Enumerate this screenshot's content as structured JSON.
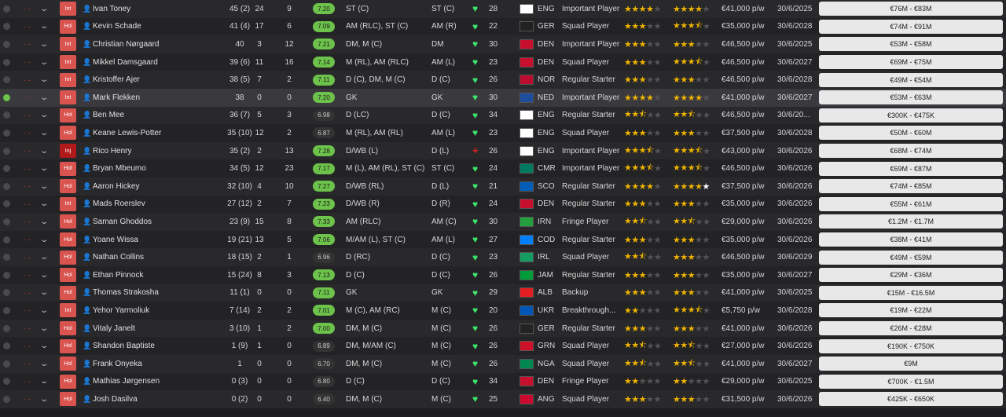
{
  "flag_colors": {
    "ENG": "#ffffff",
    "GER": "#222222",
    "DEN": "#c8102e",
    "NOR": "#ba0c2f",
    "NED": "#1e4d9e",
    "CMR": "#007a5e",
    "SCO": "#005eb8",
    "IRN": "#239f40",
    "COD": "#007fff",
    "IRL": "#169b62",
    "JAM": "#009b3a",
    "ALB": "#e41e20",
    "UKR": "#0057b7",
    "GRN": "#ce1126",
    "NGA": "#008751",
    "ANG": "#cc092f"
  },
  "players": [
    {
      "status": "Int",
      "name": "Ivan Toney",
      "apps": "45 (2)",
      "goals": "24",
      "ast": "9",
      "rating": "7.20",
      "pos": "ST (C)",
      "bpos": "ST (C)",
      "age": "28",
      "nat": "ENG",
      "role": "Important Player",
      "stars1": 4,
      "stars2": 4,
      "wage": "€41,000 p/w",
      "exp": "30/6/2025",
      "value": "€76M - €83M"
    },
    {
      "status": "Hol",
      "name": "Kevin Schade",
      "apps": "41 (4)",
      "goals": "17",
      "ast": "6",
      "rating": "7.09",
      "pos": "AM (RLC), ST (C)",
      "bpos": "AM (R)",
      "age": "22",
      "nat": "GER",
      "role": "Squad Player",
      "stars1": 3,
      "stars2": 3.5,
      "wage": "€35,000 p/w",
      "exp": "30/6/2028",
      "value": "€74M - €91M"
    },
    {
      "status": "Int",
      "name": "Christian Nørgaard",
      "apps": "40",
      "goals": "3",
      "ast": "12",
      "rating": "7.21",
      "pos": "DM, M (C)",
      "bpos": "DM",
      "age": "30",
      "nat": "DEN",
      "role": "Important Player",
      "stars1": 3,
      "stars2": 3,
      "wage": "€46,500 p/w",
      "exp": "30/6/2025",
      "value": "€53M - €58M"
    },
    {
      "status": "Int",
      "name": "Mikkel Damsgaard",
      "apps": "39 (6)",
      "goals": "11",
      "ast": "16",
      "rating": "7.14",
      "pos": "M (RL), AM (RLC)",
      "bpos": "AM (L)",
      "age": "23",
      "nat": "DEN",
      "role": "Squad Player",
      "stars1": 3,
      "stars2": 3.5,
      "wage": "€46,500 p/w",
      "exp": "30/6/2027",
      "value": "€69M - €75M"
    },
    {
      "status": "Int",
      "name": "Kristoffer Ajer",
      "apps": "38 (5)",
      "goals": "7",
      "ast": "2",
      "rating": "7.11",
      "pos": "D (C), DM, M (C)",
      "bpos": "D (C)",
      "age": "26",
      "nat": "NOR",
      "role": "Regular Starter",
      "stars1": 3,
      "stars2": 3,
      "wage": "€46,500 p/w",
      "exp": "30/6/2028",
      "value": "€49M - €54M"
    },
    {
      "status": "Int",
      "name": "Mark Flekken",
      "apps": "38",
      "goals": "0",
      "ast": "0",
      "rating": "7.20",
      "pos": "GK",
      "bpos": "GK",
      "age": "30",
      "nat": "NED",
      "role": "Important Player",
      "stars1": 4,
      "stars2": 4,
      "wage": "€41,000 p/w",
      "exp": "30/6/2027",
      "value": "€53M - €63M"
    },
    {
      "status": "Hol",
      "name": "Ben Mee",
      "apps": "36 (7)",
      "goals": "5",
      "ast": "3",
      "rating": "6.98",
      "pos": "D (LC)",
      "bpos": "D (C)",
      "age": "34",
      "nat": "ENG",
      "role": "Regular Starter",
      "stars1": 2.5,
      "stars2": 2.5,
      "wage": "€46,500 p/w",
      "exp": "30/6/20...",
      "value": "€300K - €475K"
    },
    {
      "status": "Hol",
      "name": "Keane Lewis-Potter",
      "apps": "35 (10)",
      "goals": "12",
      "ast": "2",
      "rating": "6.87",
      "pos": "M (RL), AM (RL)",
      "bpos": "AM (L)",
      "age": "23",
      "nat": "ENG",
      "role": "Squad Player",
      "stars1": 3,
      "stars2": 3,
      "wage": "€37,500 p/w",
      "exp": "30/6/2028",
      "value": "€50M - €60M"
    },
    {
      "status": "Inj",
      "name": "Rico Henry",
      "apps": "35 (2)",
      "goals": "2",
      "ast": "13",
      "rating": "7.28",
      "pos": "D/WB (L)",
      "bpos": "D (L)",
      "age": "26",
      "nat": "ENG",
      "role": "Important Player",
      "stars1": 3.5,
      "stars2": 3.5,
      "wage": "€43,000 p/w",
      "exp": "30/6/2026",
      "value": "€68M - €74M"
    },
    {
      "status": "Hol",
      "name": "Bryan Mbeumo",
      "apps": "34 (5)",
      "goals": "12",
      "ast": "23",
      "rating": "7.17",
      "pos": "M (L), AM (RL), ST (C)",
      "bpos": "ST (C)",
      "age": "24",
      "nat": "CMR",
      "role": "Important Player",
      "stars1": 3.5,
      "stars2": 3.5,
      "wage": "€46,500 p/w",
      "exp": "30/6/2026",
      "value": "€69M - €87M"
    },
    {
      "status": "Hol",
      "name": "Aaron Hickey",
      "apps": "32 (10)",
      "goals": "4",
      "ast": "10",
      "rating": "7.27",
      "pos": "D/WB (RL)",
      "bpos": "D (L)",
      "age": "21",
      "nat": "SCO",
      "role": "Regular Starter",
      "stars1": 4,
      "stars2": 5,
      "wage": "€37,500 p/w",
      "exp": "30/6/2026",
      "value": "€74M - €85M"
    },
    {
      "status": "Int",
      "name": "Mads Roerslev",
      "apps": "27 (12)",
      "goals": "2",
      "ast": "7",
      "rating": "7.23",
      "pos": "D/WB (R)",
      "bpos": "D (R)",
      "age": "24",
      "nat": "DEN",
      "role": "Regular Starter",
      "stars1": 3,
      "stars2": 3,
      "wage": "€35,000 p/w",
      "exp": "30/6/2026",
      "value": "€55M - €61M"
    },
    {
      "status": "Hol",
      "name": "Saman Ghoddos",
      "apps": "23 (9)",
      "goals": "15",
      "ast": "8",
      "rating": "7.33",
      "pos": "AM (RLC)",
      "bpos": "AM (C)",
      "age": "30",
      "nat": "IRN",
      "role": "Fringe Player",
      "stars1": 2.5,
      "stars2": 2.5,
      "wage": "€29,000 p/w",
      "exp": "30/6/2026",
      "value": "€1.2M - €1.7M"
    },
    {
      "status": "Hol",
      "name": "Yoane Wissa",
      "apps": "19 (21)",
      "goals": "13",
      "ast": "5",
      "rating": "7.06",
      "pos": "M/AM (L), ST (C)",
      "bpos": "AM (L)",
      "age": "27",
      "nat": "COD",
      "role": "Regular Starter",
      "stars1": 3,
      "stars2": 3,
      "wage": "€35,000 p/w",
      "exp": "30/6/2026",
      "value": "€38M - €41M"
    },
    {
      "status": "Hol",
      "name": "Nathan Collins",
      "apps": "18 (15)",
      "goals": "2",
      "ast": "1",
      "rating": "6.96",
      "pos": "D (RC)",
      "bpos": "D (C)",
      "age": "23",
      "nat": "IRL",
      "role": "Squad Player",
      "stars1": 2.5,
      "stars2": 3,
      "wage": "€46,500 p/w",
      "exp": "30/6/2029",
      "value": "€49M - €59M"
    },
    {
      "status": "Hol",
      "name": "Ethan Pinnock",
      "apps": "15 (24)",
      "goals": "8",
      "ast": "3",
      "rating": "7.13",
      "pos": "D (C)",
      "bpos": "D (C)",
      "age": "26",
      "nat": "JAM",
      "role": "Regular Starter",
      "stars1": 3,
      "stars2": 3,
      "wage": "€35,000 p/w",
      "exp": "30/6/2027",
      "value": "€29M - €36M"
    },
    {
      "status": "Hol",
      "name": "Thomas Strakosha",
      "apps": "11 (1)",
      "goals": "0",
      "ast": "0",
      "rating": "7.11",
      "pos": "GK",
      "bpos": "GK",
      "age": "29",
      "nat": "ALB",
      "role": "Backup",
      "stars1": 3,
      "stars2": 3,
      "wage": "€41,000 p/w",
      "exp": "30/6/2025",
      "value": "€15M - €16.5M"
    },
    {
      "status": "Int",
      "name": "Yehor Yarmoliuk",
      "apps": "7 (14)",
      "goals": "2",
      "ast": "2",
      "rating": "7.01",
      "pos": "M (C), AM (RC)",
      "bpos": "M (C)",
      "age": "20",
      "nat": "UKR",
      "role": "Breakthrough...",
      "stars1": 2,
      "stars2": 3.5,
      "wage": "€5,750 p/w",
      "exp": "30/6/2028",
      "value": "€19M - €22M"
    },
    {
      "status": "Hol",
      "name": "Vitaly Janelt",
      "apps": "3 (10)",
      "goals": "1",
      "ast": "2",
      "rating": "7.00",
      "pos": "DM, M (C)",
      "bpos": "M (C)",
      "age": "26",
      "nat": "GER",
      "role": "Regular Starter",
      "stars1": 3,
      "stars2": 3,
      "wage": "€41,000 p/w",
      "exp": "30/6/2026",
      "value": "€26M - €28M"
    },
    {
      "status": "Hol",
      "name": "Shandon Baptiste",
      "apps": "1 (9)",
      "goals": "1",
      "ast": "0",
      "rating": "6.89",
      "pos": "DM, M/AM (C)",
      "bpos": "M (C)",
      "age": "26",
      "nat": "GRN",
      "role": "Squad Player",
      "stars1": 2.5,
      "stars2": 2.5,
      "wage": "€27,000 p/w",
      "exp": "30/6/2026",
      "value": "€190K - €750K"
    },
    {
      "status": "Hol",
      "name": "Frank Onyeka",
      "apps": "1",
      "goals": "0",
      "ast": "0",
      "rating": "6.70",
      "pos": "DM, M (C)",
      "bpos": "M (C)",
      "age": "26",
      "nat": "NGA",
      "role": "Squad Player",
      "stars1": 2.5,
      "stars2": 2.5,
      "wage": "€41,000 p/w",
      "exp": "30/6/2027",
      "value": "€9M"
    },
    {
      "status": "Hol",
      "name": "Mathias Jørgensen",
      "apps": "0 (3)",
      "goals": "0",
      "ast": "0",
      "rating": "6.80",
      "pos": "D (C)",
      "bpos": "D (C)",
      "age": "34",
      "nat": "DEN",
      "role": "Fringe Player",
      "stars1": 2,
      "stars2": 2,
      "wage": "€29,000 p/w",
      "exp": "30/6/2025",
      "value": "€700K - €1.5M"
    },
    {
      "status": "Hol",
      "name": "Josh Dasilva",
      "apps": "0 (2)",
      "goals": "0",
      "ast": "0",
      "rating": "6.40",
      "pos": "DM, M (C)",
      "bpos": "M (C)",
      "age": "25",
      "nat": "ANG",
      "role": "Squad Player",
      "stars1": 3,
      "stars2": 3,
      "wage": "€31,500 p/w",
      "exp": "30/6/2026",
      "value": "€425K - €650K"
    }
  ]
}
